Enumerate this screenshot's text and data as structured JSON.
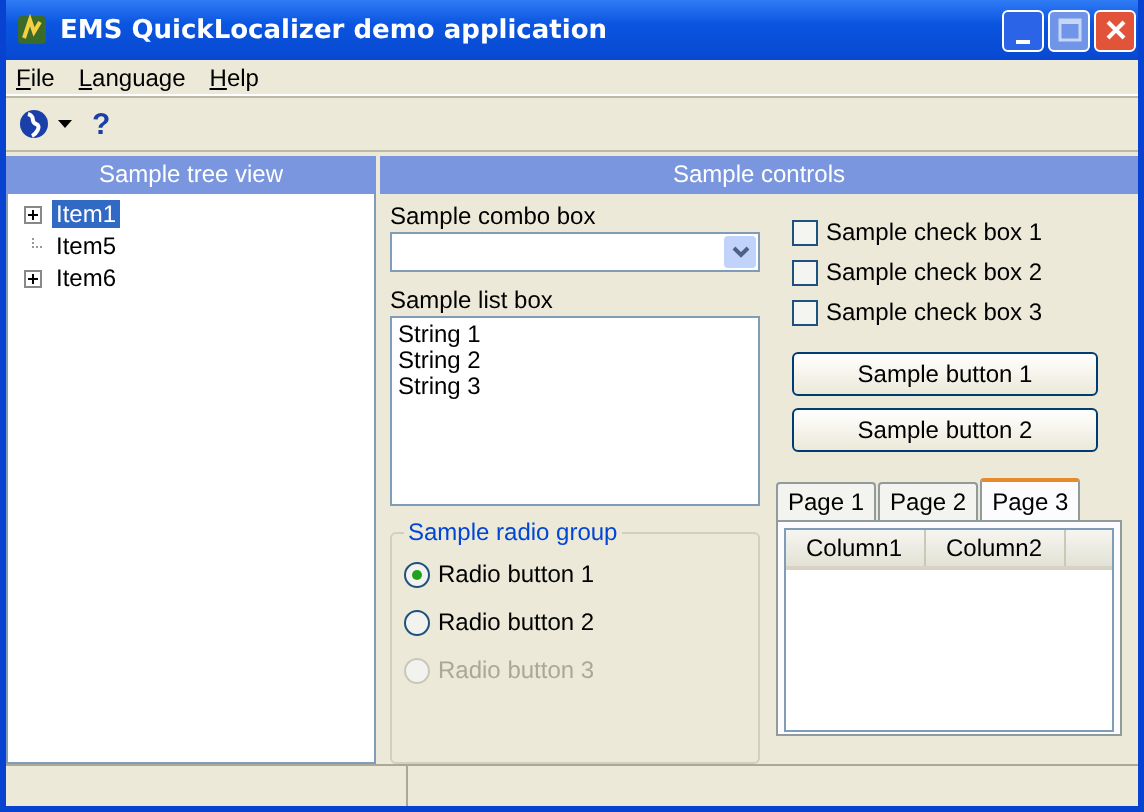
{
  "window": {
    "title": "EMS QuickLocalizer demo application"
  },
  "menu": [
    "File",
    "Language",
    "Help"
  ],
  "toolbar": {
    "help_glyph": "?"
  },
  "tree_panel": {
    "header": "Sample tree view",
    "nodes": [
      {
        "label": "Item1",
        "selected": true,
        "expandable": true
      },
      {
        "label": "Item5",
        "selected": false,
        "expandable": false
      },
      {
        "label": "Item6",
        "selected": false,
        "expandable": true
      }
    ]
  },
  "controls_panel": {
    "header": "Sample controls",
    "combo_label": "Sample combo box",
    "list_label": "Sample list box",
    "list_items": [
      "String 1",
      "String 2",
      "String 3"
    ],
    "radio_group": {
      "title": "Sample radio group",
      "options": [
        {
          "label": "Radio button 1",
          "selected": true,
          "disabled": false
        },
        {
          "label": "Radio button 2",
          "selected": false,
          "disabled": false
        },
        {
          "label": "Radio button 3",
          "selected": false,
          "disabled": true
        }
      ]
    },
    "checkboxes": [
      {
        "label": "Sample check box 1",
        "checked": false
      },
      {
        "label": "Sample check box 2",
        "checked": false
      },
      {
        "label": "Sample check box 3",
        "checked": false
      }
    ],
    "buttons": [
      "Sample button 1",
      "Sample button 2"
    ],
    "tabs": [
      {
        "label": "Page 1",
        "selected": false
      },
      {
        "label": "Page 2",
        "selected": false
      },
      {
        "label": "Page 3",
        "selected": true
      }
    ],
    "table_columns": [
      "Column1",
      "Column2"
    ]
  }
}
